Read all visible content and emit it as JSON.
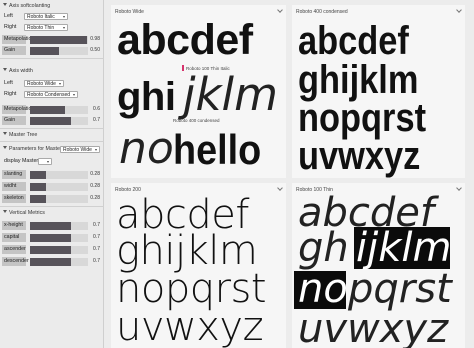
{
  "panel": {
    "axis_softcolanting": {
      "title": "Axis softcolanting",
      "left_label": "Left",
      "left_value": "Roboto Italic",
      "right_label": "Right",
      "right_value": "Roboto Thin",
      "metapolation_label": "Metapolation",
      "metapolation_value": "0.98",
      "metapolation_level": 0.98,
      "gain_label": "Gain",
      "gain_value": "0.50",
      "gain_level": 0.5
    },
    "axis_width": {
      "title": "Axis width",
      "left_label": "Left",
      "left_value": "Roboto Wide",
      "right_label": "Right",
      "right_value": "Roboto Condensed",
      "metapolation_label": "Metapolation",
      "metapolation_value": "0.6",
      "metapolation_level": 0.6,
      "gain_label": "Gain",
      "gain_value": "0.7",
      "gain_level": 0.7
    },
    "master_tree": {
      "title": "Master Tree"
    },
    "parameters": {
      "title": "Parameters for Master",
      "master_value": "Roboto Wide",
      "display_master_label": "display Master",
      "slanting_label": "slanting",
      "slanting_value": "0.28",
      "slanting_level": 0.28,
      "width_label": "widht",
      "width_value": "0.28",
      "width_level": 0.28,
      "skeleton_label": "skeleton",
      "skeleton_value": "0.28",
      "skeleton_level": 0.28
    },
    "vertical_metrics": {
      "title": "Vertical Metrics",
      "rows": [
        {
          "label": "x-height",
          "value": "0.7",
          "level": 0.7
        },
        {
          "label": "capital",
          "value": "0.7",
          "level": 0.7
        },
        {
          "label": "ascender",
          "value": "0.7",
          "level": 0.7
        },
        {
          "label": "descender",
          "value": "0.7",
          "level": 0.7
        }
      ]
    }
  },
  "cards": {
    "top_left": {
      "caption": "Roboto Wide",
      "line1": "abcdef",
      "mini_label": "Roboto 100 Thin Italic",
      "line2_a": "ghi",
      "line2_b": "jklm",
      "mini_label2": "Roboto 400 condensed",
      "line3_a": "no",
      "line3_b": "hello"
    },
    "top_right": {
      "caption": "Roboto 400 condensed",
      "lines": [
        "abcdef",
        "ghijklm",
        "nopqrst",
        "uvwxyz"
      ]
    },
    "bottom_left": {
      "caption": "Roboto 200",
      "lines": [
        "abcdef",
        "ghijklm",
        "nopqrst",
        "uvwxyz"
      ]
    },
    "bottom_right": {
      "caption": "Roboto 100 Thin",
      "line1": "abcdef",
      "line2_a": "gh",
      "line2_b": "ijklm",
      "line3_a": "no",
      "line3_b": "pqrst",
      "line4": "uvwxyz"
    }
  }
}
